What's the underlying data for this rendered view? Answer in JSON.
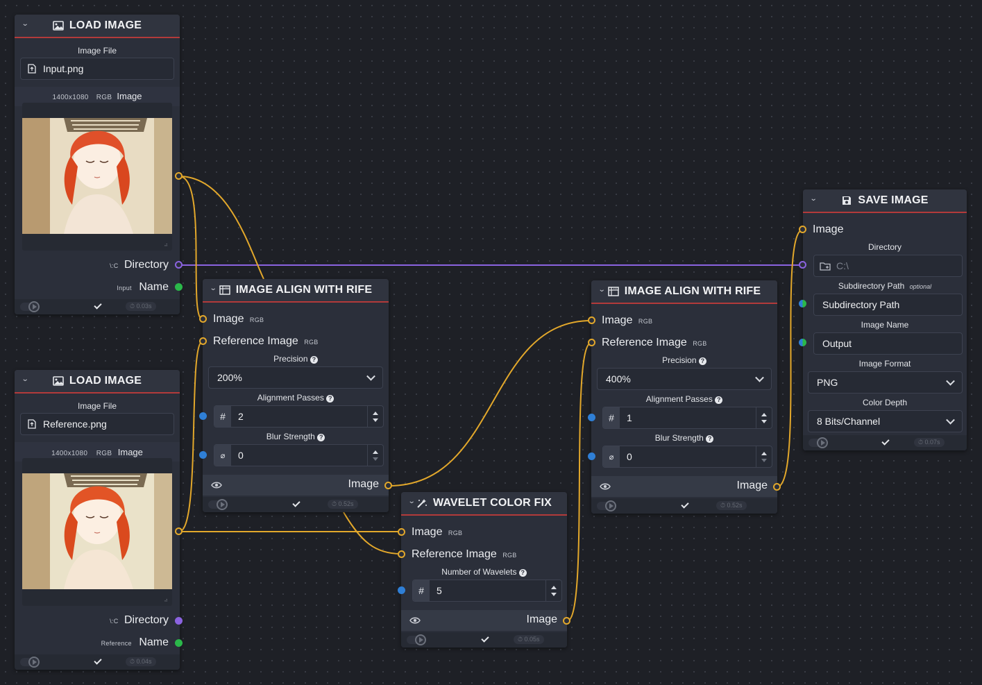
{
  "colors": {
    "image": "#e3a82b",
    "directory": "#8b63e0",
    "name": "#2bb84a",
    "number": "#2f7fd6",
    "header_accent": "#b33a3a",
    "background": "#1e2026",
    "node": "#2b2f3a"
  },
  "load_image_1": {
    "title": "LOAD IMAGE",
    "icon": "image-icon",
    "file_label": "Image File",
    "file_value": "Input.png",
    "meta_size": "1400x1080",
    "meta_mode": "RGB",
    "meta_label": "Image",
    "directory_tag": "\\:C",
    "directory_label": "Directory",
    "name_tag": "Input",
    "name_label": "Name",
    "timer": "0.03s"
  },
  "load_image_2": {
    "title": "LOAD IMAGE",
    "icon": "image-icon",
    "file_label": "Image File",
    "file_value": "Reference.png",
    "meta_size": "1400x1080",
    "meta_mode": "RGB",
    "meta_label": "Image",
    "directory_tag": "\\:C",
    "directory_label": "Directory",
    "name_tag": "Reference",
    "name_label": "Name",
    "timer": "0.04s"
  },
  "align_1": {
    "title": "IMAGE ALIGN WITH RIFE",
    "icon": "align-icon",
    "in_image": "Image",
    "in_image_tag": "RGB",
    "in_ref": "Reference Image",
    "in_ref_tag": "RGB",
    "precision_label": "Precision",
    "precision_value": "200%",
    "passes_label": "Alignment Passes",
    "passes_value": "2",
    "blur_label": "Blur Strength",
    "blur_value": "0",
    "out_image": "Image",
    "timer": "0.52s"
  },
  "align_2": {
    "title": "IMAGE ALIGN WITH RIFE",
    "icon": "align-icon",
    "in_image": "Image",
    "in_image_tag": "RGB",
    "in_ref": "Reference Image",
    "in_ref_tag": "RGB",
    "precision_label": "Precision",
    "precision_value": "400%",
    "passes_label": "Alignment Passes",
    "passes_value": "1",
    "blur_label": "Blur Strength",
    "blur_value": "0",
    "out_image": "Image",
    "timer": "0.52s"
  },
  "wavelet": {
    "title": "WAVELET COLOR FIX",
    "icon": "magic-wand-icon",
    "in_image": "Image",
    "in_image_tag": "RGB",
    "in_ref": "Reference Image",
    "in_ref_tag": "RGB",
    "wavelets_label": "Number of Wavelets",
    "wavelets_value": "5",
    "out_image": "Image",
    "timer": "0.05s"
  },
  "save_image": {
    "title": "SAVE IMAGE",
    "icon": "save-icon",
    "in_image": "Image",
    "directory_label": "Directory",
    "directory_placeholder": "C:\\",
    "subdir_label": "Subdirectory Path",
    "subdir_tag": "optional",
    "subdir_value": "Subdirectory Path",
    "name_label": "Image Name",
    "name_value": "Output",
    "format_label": "Image Format",
    "format_value": "PNG",
    "depth_label": "Color Depth",
    "depth_value": "8 Bits/Channel",
    "timer": "0.07s"
  }
}
